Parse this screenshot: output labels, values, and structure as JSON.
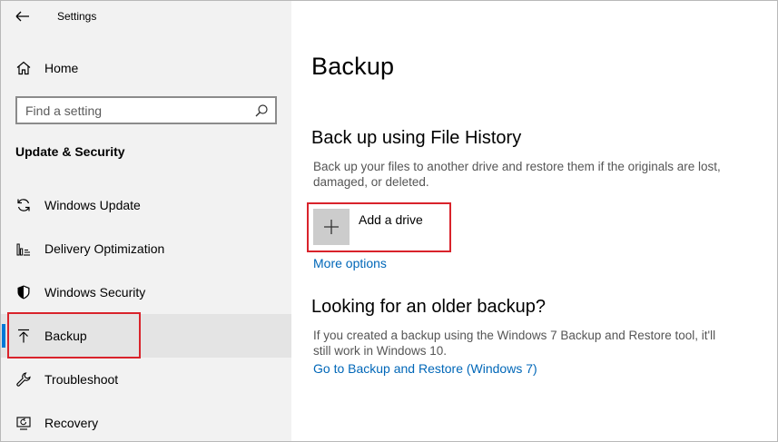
{
  "window": {
    "title": "Settings"
  },
  "sidebar": {
    "home_label": "Home",
    "search_placeholder": "Find a setting",
    "section_title": "Update & Security",
    "items": [
      {
        "label": "Windows Update",
        "icon": "refresh-icon"
      },
      {
        "label": "Delivery Optimization",
        "icon": "delivery-optimization-icon"
      },
      {
        "label": "Windows Security",
        "icon": "shield-icon"
      },
      {
        "label": "Backup",
        "icon": "upload-arrow-icon",
        "selected": true
      },
      {
        "label": "Troubleshoot",
        "icon": "wrench-icon"
      },
      {
        "label": "Recovery",
        "icon": "recovery-icon"
      }
    ]
  },
  "main": {
    "title": "Backup",
    "file_history": {
      "heading": "Back up using File History",
      "description": "Back up your files to another drive and restore them if the originals are lost, damaged, or deleted.",
      "add_drive_label": "Add a drive",
      "more_options_label": "More options"
    },
    "older_backup": {
      "heading": "Looking for an older backup?",
      "description": "If you created a backup using the Windows 7 Backup and Restore tool, it'll still work in Windows 10.",
      "link_label": "Go to Backup and Restore (Windows 7)"
    }
  },
  "colors": {
    "accent": "#0078d7",
    "link": "#0067b8",
    "highlight_box": "#d9232b",
    "sidebar_bg": "#f2f2f2",
    "selected_bg": "#e4e4e4"
  }
}
